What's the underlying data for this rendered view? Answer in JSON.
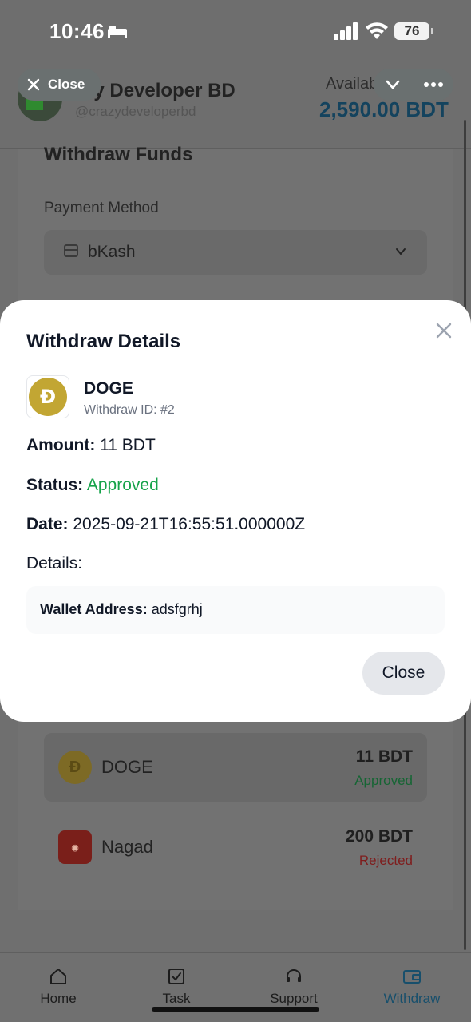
{
  "status_bar": {
    "time": "10:46",
    "battery": "76"
  },
  "webview": {
    "close_label": "Close"
  },
  "header": {
    "user_name": "azy Developer BD",
    "user_handle": "@crazydeveloperbd",
    "balance_label": "Availab",
    "balance_value": "2,590.00 BDT"
  },
  "withdraw_form": {
    "title": "Withdraw Funds",
    "payment_method_label": "Payment Method",
    "payment_method_value": "bKash"
  },
  "history": [
    {
      "name": "DOGE",
      "amount": "11 BDT",
      "status": "Approved",
      "status_color": "#166534"
    },
    {
      "name": "Nagad",
      "amount": "200 BDT",
      "status": "Rejected",
      "status_color": "#7f1d1d"
    }
  ],
  "nav": {
    "items": [
      {
        "label": "Home",
        "icon": "home-icon"
      },
      {
        "label": "Task",
        "icon": "task-icon"
      },
      {
        "label": "Support",
        "icon": "headset-icon"
      },
      {
        "label": "Withdraw",
        "icon": "wallet-icon"
      }
    ],
    "active": "Withdraw"
  },
  "modal": {
    "title": "Withdraw Details",
    "coin_name": "DOGE",
    "withdraw_id": "Withdraw ID: #2",
    "amount_label": "Amount:",
    "amount_value": "11 BDT",
    "status_label": "Status:",
    "status_value": "Approved",
    "date_label": "Date:",
    "date_value": "2025-09-21T16:55:51.000000Z",
    "details_label": "Details:",
    "wallet_label": "Wallet Address:",
    "wallet_value": "adsfgrhj",
    "close_button": "Close",
    "accent_green": "#16a34a",
    "doge_color": "#c2a633"
  }
}
